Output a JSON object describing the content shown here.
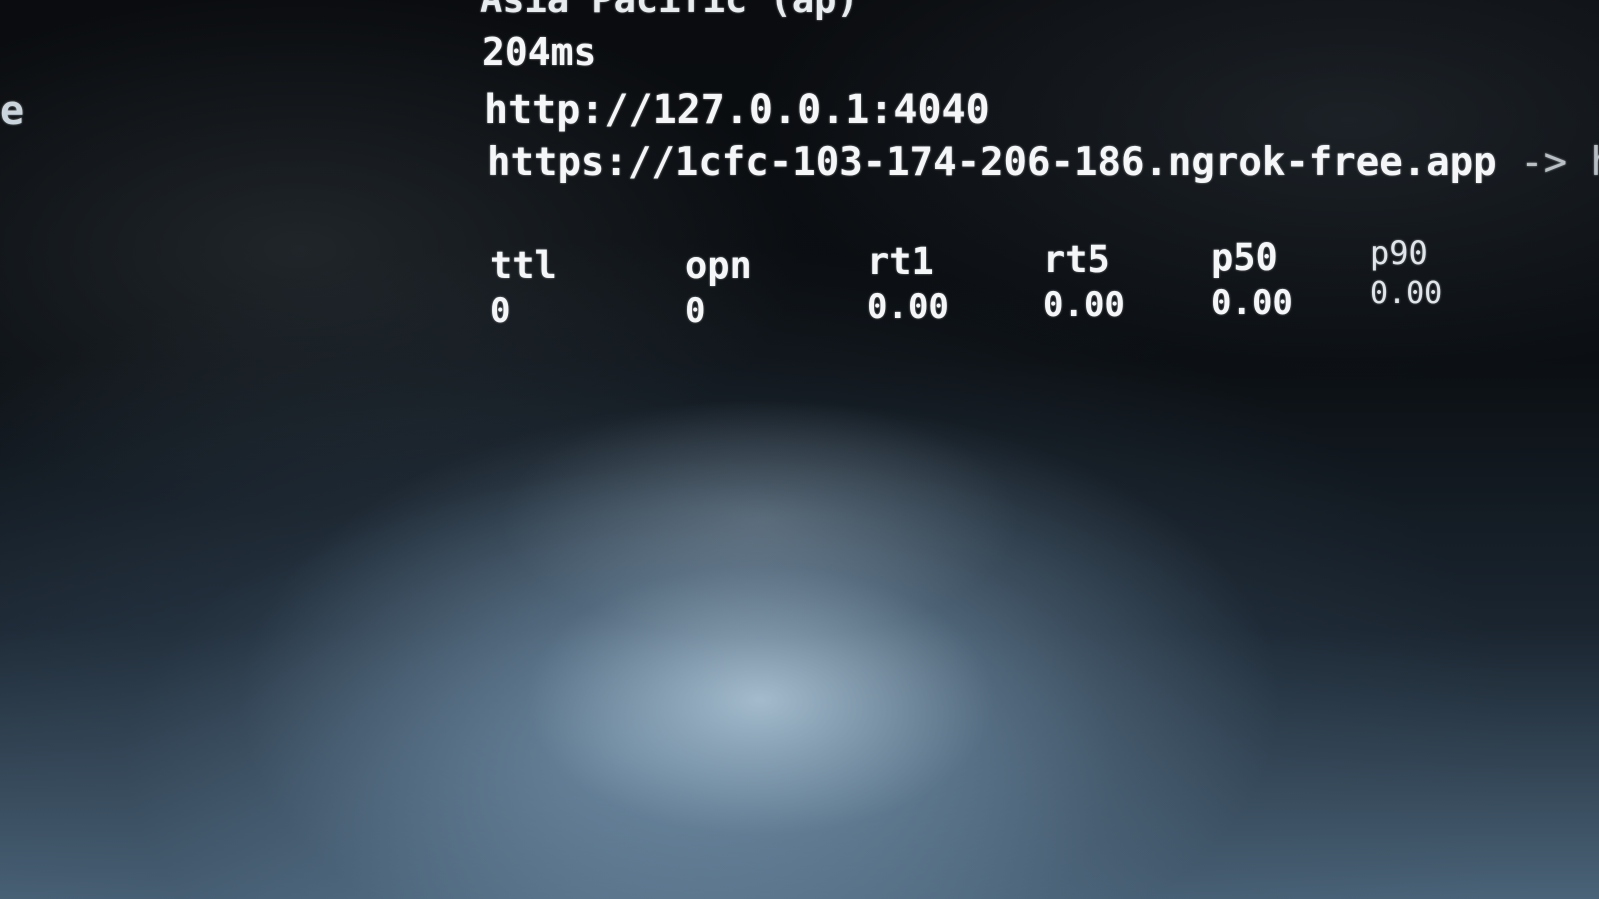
{
  "terminal": {
    "region": "Asia Pacific (ap)",
    "latency": "204ms",
    "web_interface": "http://127.0.0.1:4040",
    "forwarding_url": "https://1cfc-103-174-206-186.ngrok-free.app",
    "forwarding_arrow": " -> http",
    "left_edge_char": "e"
  },
  "connections": {
    "columns": [
      {
        "header": "ttl",
        "value": "0"
      },
      {
        "header": "opn",
        "value": "0"
      },
      {
        "header": "rt1",
        "value": "0.00"
      },
      {
        "header": "rt5",
        "value": "0.00"
      },
      {
        "header": "p50",
        "value": "0.00"
      },
      {
        "header": "p90",
        "value": "0.00"
      }
    ]
  },
  "colors": {
    "text": "#f4f6f8",
    "background": "#07090c"
  }
}
